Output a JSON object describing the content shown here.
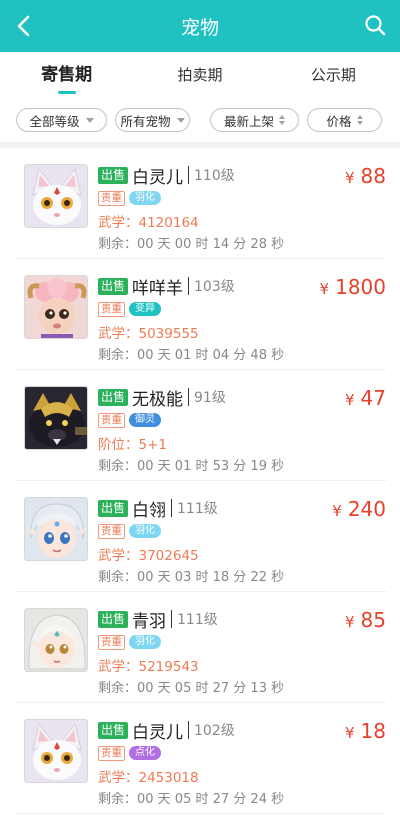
{
  "header": {
    "title": "宠物"
  },
  "tabs": [
    {
      "label": "寄售期",
      "active": true
    },
    {
      "label": "拍卖期",
      "active": false
    },
    {
      "label": "公示期",
      "active": false
    }
  ],
  "filters": {
    "level": "全部等级",
    "pets": "所有宠物",
    "newest": "最新上架",
    "price": "价格"
  },
  "colors": {
    "accent": "#1fc2c0",
    "price": "#e8412b",
    "sale": "#2bb15a",
    "stat": "#ee7b54"
  },
  "items": [
    {
      "sale_label": "出售",
      "name": "白灵儿",
      "level": "110级",
      "price_sym": "¥",
      "price": "88",
      "tag_quality": "贵重",
      "tag_type": "羽化",
      "tag_color": "#7ed6f0",
      "stat": "武学：4120164",
      "remaining": "剩余：00 天 00 时 14 分 28 秒",
      "avatar_icon": "white-fox-pet-icon"
    },
    {
      "sale_label": "出售",
      "name": "咩咩羊",
      "level": "103级",
      "price_sym": "¥",
      "price": "1800",
      "tag_quality": "贵重",
      "tag_type": "变异",
      "tag_color": "#1fc2c0",
      "stat": "武学：5039555",
      "remaining": "剩余：00 天 01 时 04 分 48 秒",
      "avatar_icon": "pink-sheep-pet-icon"
    },
    {
      "sale_label": "出售",
      "name": "无极能",
      "level": "91级",
      "price_sym": "¥",
      "price": "47",
      "tag_quality": "贵重",
      "tag_type": "御灵",
      "tag_color": "#3f8ee0",
      "stat": "阶位：5+1",
      "remaining": "剩余：00 天 01 时 53 分 19 秒",
      "avatar_icon": "armored-bear-pet-icon"
    },
    {
      "sale_label": "出售",
      "name": "白翎",
      "level": "111级",
      "price_sym": "¥",
      "price": "240",
      "tag_quality": "贵重",
      "tag_type": "羽化",
      "tag_color": "#7ed6f0",
      "stat": "武学：3702645",
      "remaining": "剩余：00 天 03 时 18 分 22 秒",
      "avatar_icon": "silver-hair-boy-pet-icon"
    },
    {
      "sale_label": "出售",
      "name": "青羽",
      "level": "111级",
      "price_sym": "¥",
      "price": "85",
      "tag_quality": "贵重",
      "tag_type": "羽化",
      "tag_color": "#7ed6f0",
      "stat": "武学：5219543",
      "remaining": "剩余：00 天 05 时 27 分 13 秒",
      "avatar_icon": "white-hair-elf-pet-icon"
    },
    {
      "sale_label": "出售",
      "name": "白灵儿",
      "level": "102级",
      "price_sym": "¥",
      "price": "18",
      "tag_quality": "贵重",
      "tag_type": "点化",
      "tag_color": "#b06ee0",
      "stat": "武学：2453018",
      "remaining": "剩余：00 天 05 时 27 分 24 秒",
      "avatar_icon": "white-fox-pet-icon"
    }
  ]
}
